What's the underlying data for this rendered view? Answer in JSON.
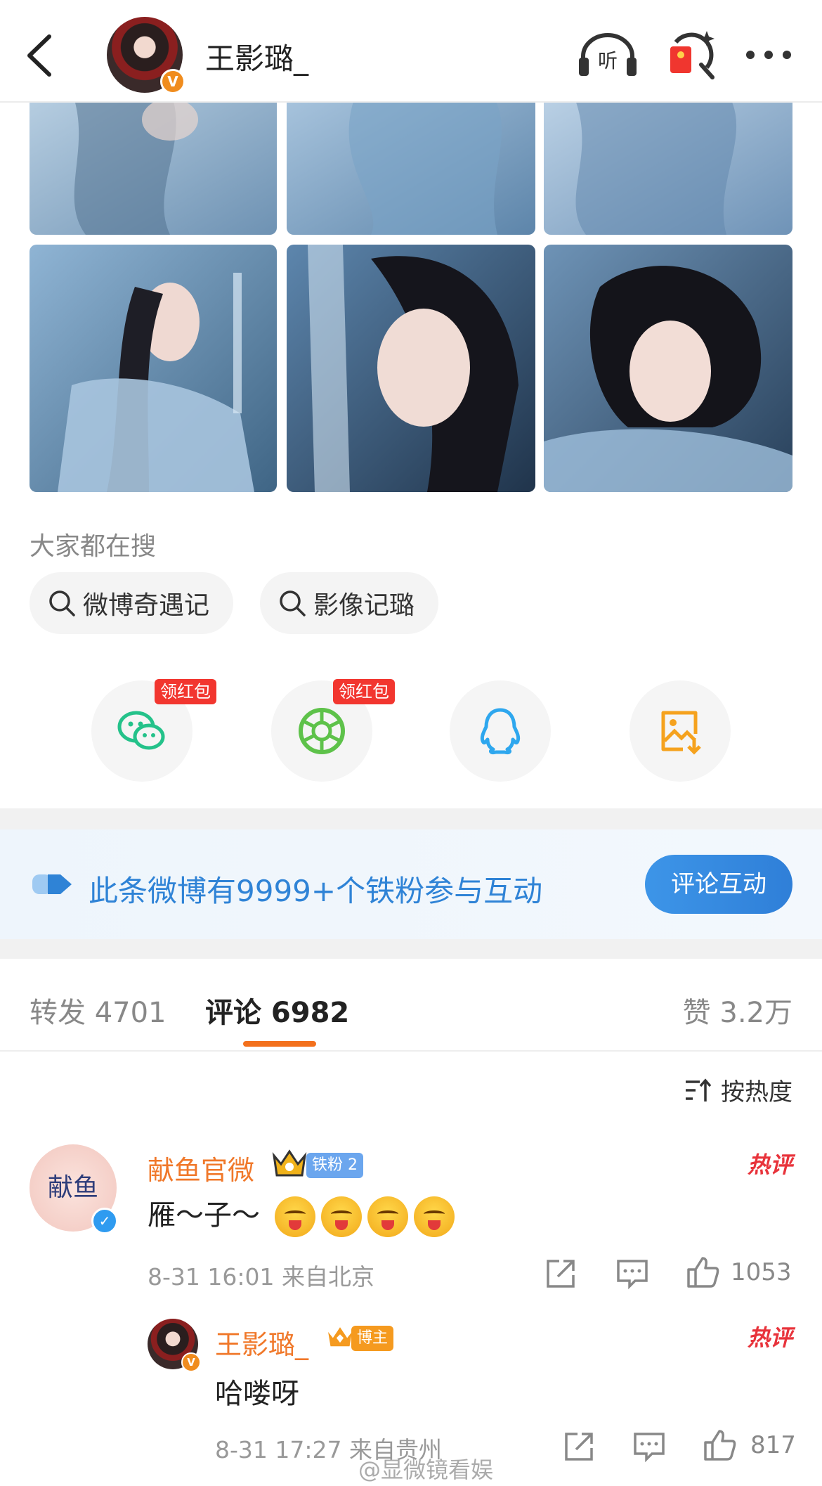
{
  "header": {
    "name": "王影璐_",
    "listen_label": "听"
  },
  "search": {
    "title": "大家都在搜",
    "chips": [
      "微博奇遇记",
      "影像记璐"
    ]
  },
  "share": {
    "badge_label": "领红包"
  },
  "banner": {
    "text": "此条微博有9999+个铁粉参与互动",
    "button": "评论互动"
  },
  "tabs": {
    "repost": "转发 4701",
    "comment": "评论 6982",
    "like": "赞 3.2万"
  },
  "sort_label": "按热度",
  "comments": [
    {
      "name": "献鱼官微",
      "badge": "铁粉 2",
      "text": "雁～子～",
      "meta": "8-31 16:01 来自北京",
      "likes": "1053",
      "hot": "热评",
      "avatar_text": "献鱼"
    },
    {
      "name": "王影璐_",
      "badge": "博主",
      "text": "哈喽呀",
      "meta": "8-31 17:27 来自贵州",
      "likes": "817",
      "hot": "热评"
    }
  ],
  "watermark": "@显微镜看娱",
  "colors": {
    "accent_orange": "#f3701c",
    "link_blue": "#2f83d6",
    "hot_red": "#e8333b"
  }
}
